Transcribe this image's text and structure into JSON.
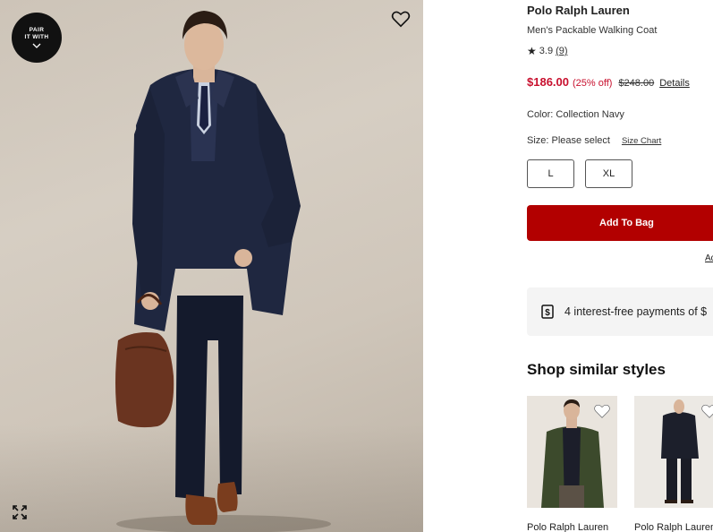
{
  "pair_badge": {
    "line1": "PAIR",
    "line2": "IT WITH"
  },
  "product": {
    "brand": "Polo Ralph Lauren",
    "name": "Men's Packable Walking Coat",
    "rating_value": "3.9",
    "review_count": "(9)",
    "sale_price": "$186.00",
    "discount": "(25% off)",
    "original_price": "$248.00",
    "details_link": "Details",
    "color_label": "Color: Collection Navy",
    "size_label": "Size: Please select",
    "size_chart_link": "Size Chart",
    "sizes": [
      "L",
      "XL"
    ]
  },
  "actions": {
    "add_to_bag": "Add To Bag",
    "secondary_link": "Ad"
  },
  "payments": {
    "text": "4 interest-free payments of $"
  },
  "similar": {
    "title": "Shop similar styles",
    "items": [
      {
        "brand": "Polo Ralph Lauren"
      },
      {
        "brand": "Polo Ralph Lauren"
      }
    ]
  },
  "colors": {
    "sale_red": "#c8102e",
    "button_red": "#b20000",
    "coat_navy": "#1f2740"
  },
  "icons": [
    "heart-icon",
    "expand-icon",
    "chevron-down-icon",
    "star-icon",
    "dollar-sign-icon"
  ]
}
